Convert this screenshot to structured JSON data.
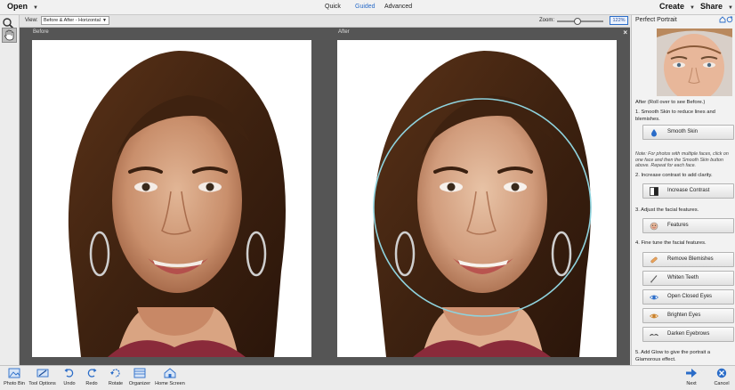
{
  "menu": {
    "open_label": "Open",
    "modes": [
      {
        "label": "Quick",
        "active": false
      },
      {
        "label": "Guided",
        "active": true
      },
      {
        "label": "Advanced",
        "active": false
      }
    ],
    "create_label": "Create",
    "share_label": "Share"
  },
  "options": {
    "view_label": "View:",
    "view_value": "Before & After - Horizontal",
    "zoom_label": "Zoom:",
    "zoom_value": "122%",
    "zoom_slider_fraction": 0.45
  },
  "tools": [
    {
      "name": "zoom-tool-icon",
      "active": false
    },
    {
      "name": "hand-tool-icon",
      "active": true
    }
  ],
  "canvas": {
    "before_label": "Before",
    "after_label": "After"
  },
  "panel": {
    "title": "Perfect Portrait",
    "preview_caption": "After (Roll over to see Before.)",
    "step1": "1. Smooth Skin to reduce lines and blemishes.",
    "smooth_skin_label": "Smooth Skin",
    "note": "Note: For photos with multiple faces, click on one face and then the Smooth Skin button above. Repeat for each face.",
    "step2": "2. Increase contrast to add clarity.",
    "increase_contrast_label": "Increase Contrast",
    "step3": "3. Adjust the facial features.",
    "features_label": "Features",
    "step4": "4. Fine tune the facial features.",
    "remove_blemishes_label": "Remove Blemishes",
    "whiten_teeth_label": "Whiten Teeth",
    "open_closed_eyes_label": "Open Closed Eyes",
    "brighten_eyes_label": "Brighten Eyes",
    "darken_eyebrows_label": "Darken Eyebrows",
    "step5": "5. Add Glow to give the portrait a Glamorous effect."
  },
  "bottom": {
    "photo_bin": "Photo Bin",
    "tool_options": "Tool Options",
    "undo": "Undo",
    "redo": "Redo",
    "rotate": "Rotate",
    "organizer": "Organizer",
    "home_screen": "Home Screen",
    "next": "Next",
    "cancel": "Cancel"
  },
  "colors": {
    "accent": "#2a6cc8",
    "canvas_bg": "#555555",
    "selection_circle": "#8fd3de"
  }
}
